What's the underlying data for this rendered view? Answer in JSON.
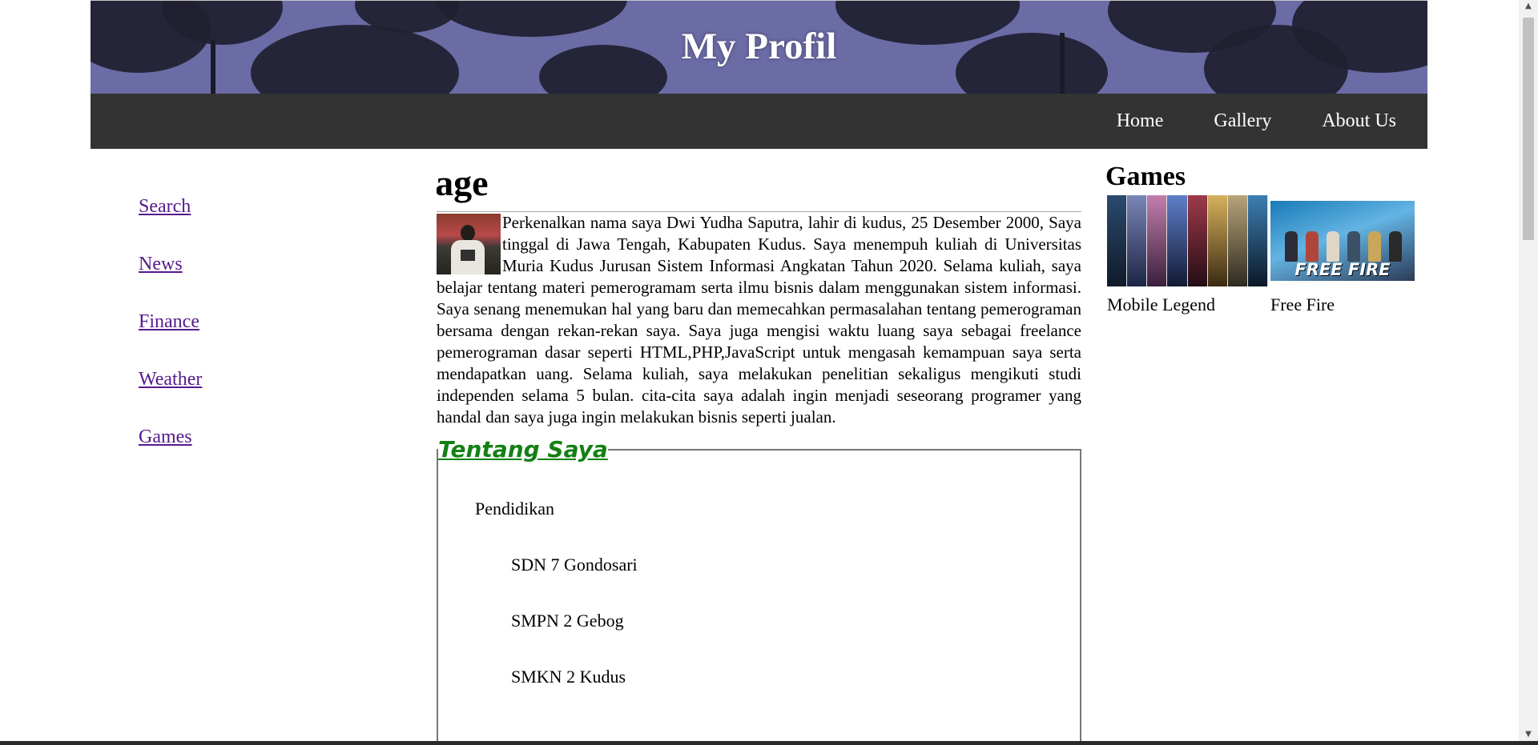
{
  "header": {
    "title": "My Profil"
  },
  "nav": {
    "items": [
      "Home",
      "Gallery",
      "About Us"
    ]
  },
  "sidebar": {
    "links": [
      "Search",
      "News",
      "Finance",
      "Weather",
      "Games"
    ]
  },
  "main": {
    "heading": "Homepage",
    "intro": "Perkenalkan nama saya Dwi Yudha Saputra, lahir di kudus, 25 Desember 2000, Saya tinggal di Jawa Tengah, Kabupaten Kudus. Saya menempuh kuliah di Universitas Muria Kudus Jurusan Sistem Informasi Angkatan Tahun 2020. Selama kuliah, saya belajar tentang materi pemerogramam serta ilmu bisnis dalam menggunakan sistem informasi. Saya senang menemukan hal yang baru dan memecahkan permasalahan tentang pemerograman bersama dengan rekan-rekan saya. Saya juga mengisi waktu luang saya sebagai freelance pemerograman dasar seperti HTML,PHP,JavaScript untuk mengasah kemampuan saya serta mendapatkan uang. Selama kuliah, saya melakukan penelitian sekaligus mengikuti studi independen selama 5 bulan. cita-cita saya adalah ingin menjadi seseorang programer yang handal dan saya juga ingin melakukan bisnis seperti jualan.",
    "about": {
      "legend": "Tentang Saya",
      "education_title": "Pendidikan",
      "schools": [
        "SDN 7 Gondosari",
        "SMPN 2 Gebog",
        "SMKN 2 Kudus"
      ]
    }
  },
  "games": {
    "title": "Games",
    "items": [
      {
        "caption": "Mobile Legend"
      },
      {
        "caption": "Free Fire",
        "logo_text": "FREE FIRE"
      }
    ]
  },
  "colors": {
    "banner": "#6b6ba6",
    "navbar": "#333333",
    "visited_link": "#551a8b",
    "legend": "#138013"
  }
}
